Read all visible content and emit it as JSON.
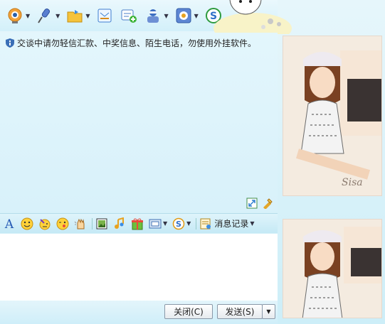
{
  "toolbar": {
    "items": [
      {
        "icon": "webcam-icon",
        "has_dropdown": true
      },
      {
        "icon": "microphone-icon",
        "has_dropdown": true
      },
      {
        "icon": "folder-transfer-icon",
        "has_dropdown": true
      },
      {
        "icon": "email-icon",
        "has_dropdown": false
      },
      {
        "icon": "add-message-icon",
        "has_dropdown": false
      },
      {
        "icon": "contact-card-icon",
        "has_dropdown": true
      },
      {
        "icon": "settings-icon",
        "has_dropdown": true
      },
      {
        "icon": "soso-icon",
        "has_dropdown": false
      }
    ]
  },
  "chat": {
    "notice": "交谈中请勿轻信汇款、中奖信息、陌生电话，勿使用外挂软件。",
    "notice_icon": "shield-info-icon"
  },
  "format_toolbar": {
    "items": [
      "font-icon",
      "smiley-icon",
      "magic-face-icon",
      "wink-face-icon",
      "shake-hand-icon",
      "image-icon",
      "music-note-icon",
      "gift-icon",
      "screenshot-icon",
      "soso-search-icon"
    ],
    "history_label": "消息记录"
  },
  "bottom": {
    "close_label": "关闭(C)",
    "send_label": "发送(S)"
  },
  "colors": {
    "accent": "#1a6fd0",
    "background": "#d7f1fa"
  }
}
